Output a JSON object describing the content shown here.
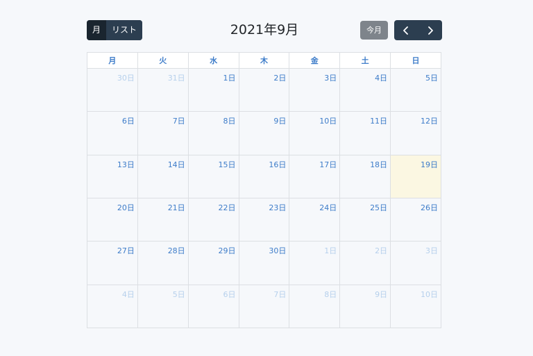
{
  "toolbar": {
    "view_month": "月",
    "view_list": "リスト",
    "title": "2021年9月",
    "today": "今月",
    "prev_icon": "chevron-left-icon",
    "next_icon": "chevron-right-icon"
  },
  "weekdays": [
    "月",
    "火",
    "水",
    "木",
    "金",
    "土",
    "日"
  ],
  "weeks": [
    [
      {
        "d": "30日",
        "other": true
      },
      {
        "d": "31日",
        "other": true
      },
      {
        "d": "1日"
      },
      {
        "d": "2日"
      },
      {
        "d": "3日"
      },
      {
        "d": "4日"
      },
      {
        "d": "5日"
      }
    ],
    [
      {
        "d": "6日"
      },
      {
        "d": "7日"
      },
      {
        "d": "8日"
      },
      {
        "d": "9日"
      },
      {
        "d": "10日"
      },
      {
        "d": "11日"
      },
      {
        "d": "12日"
      }
    ],
    [
      {
        "d": "13日"
      },
      {
        "d": "14日"
      },
      {
        "d": "15日"
      },
      {
        "d": "16日"
      },
      {
        "d": "17日"
      },
      {
        "d": "18日"
      },
      {
        "d": "19日",
        "today": true
      }
    ],
    [
      {
        "d": "20日"
      },
      {
        "d": "21日"
      },
      {
        "d": "22日"
      },
      {
        "d": "23日"
      },
      {
        "d": "24日"
      },
      {
        "d": "25日"
      },
      {
        "d": "26日"
      }
    ],
    [
      {
        "d": "27日"
      },
      {
        "d": "28日"
      },
      {
        "d": "29日"
      },
      {
        "d": "30日"
      },
      {
        "d": "1日",
        "other": true
      },
      {
        "d": "2日",
        "other": true
      },
      {
        "d": "3日",
        "other": true
      }
    ],
    [
      {
        "d": "4日",
        "other": true
      },
      {
        "d": "5日",
        "other": true
      },
      {
        "d": "6日",
        "other": true
      },
      {
        "d": "7日",
        "other": true
      },
      {
        "d": "8日",
        "other": true
      },
      {
        "d": "9日",
        "other": true
      },
      {
        "d": "10日",
        "other": true
      }
    ]
  ],
  "colors": {
    "primary": "#2c3e50",
    "active": "#1a252f",
    "secondary": "#7e848b",
    "day_text": "#3d7cc9",
    "other_month_text": "#b6d0ec",
    "today_bg": "#fbf7e2"
  }
}
